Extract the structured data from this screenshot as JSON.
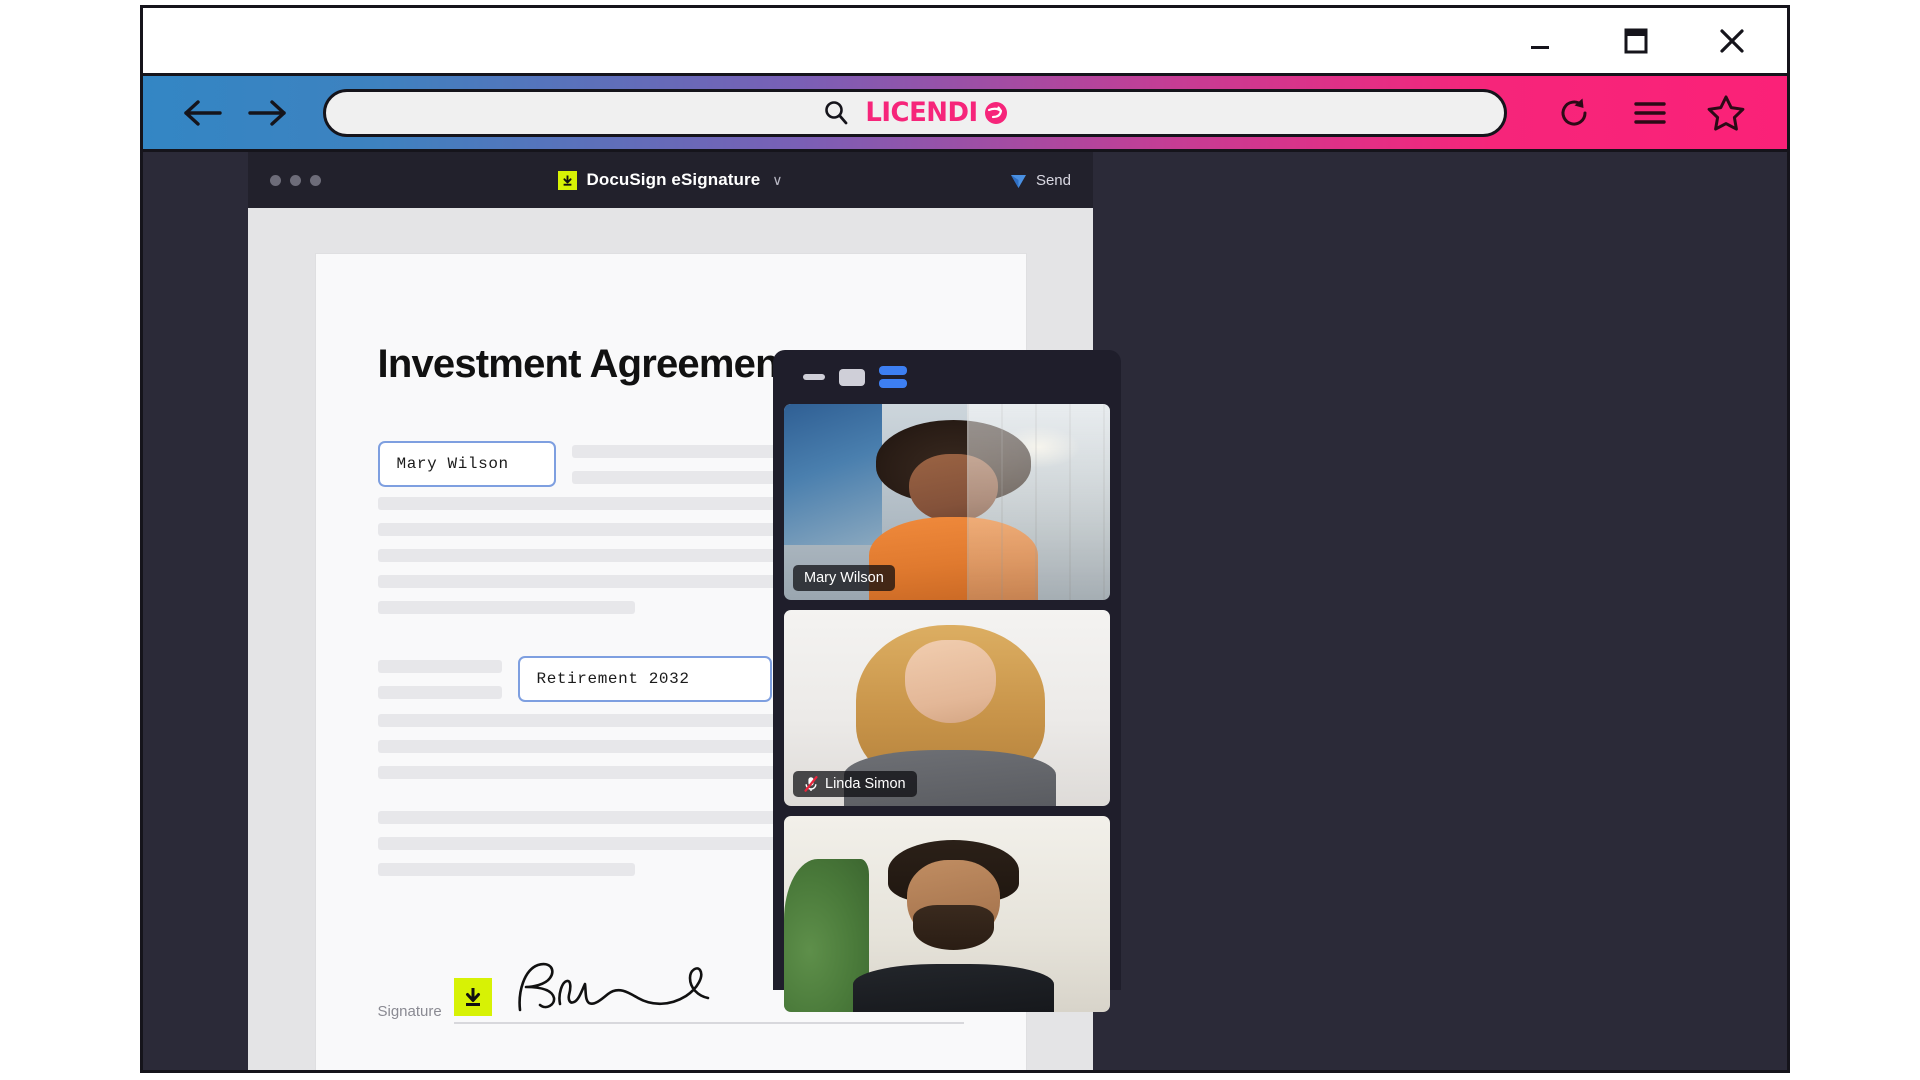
{
  "window": {
    "controls": [
      {
        "name": "minimize",
        "label": "Minimize"
      },
      {
        "name": "maximize",
        "label": "Maximize"
      },
      {
        "name": "close",
        "label": "Close"
      }
    ]
  },
  "browser": {
    "back_label": "Back",
    "forward_label": "Forward",
    "address_placeholder": "Search",
    "brand": "LICENDI",
    "brand_color": "#f6257a",
    "reload_label": "Reload",
    "menu_label": "Menu",
    "bookmark_label": "Bookmark",
    "toolbar_gradient_start": "#3386c4",
    "toolbar_gradient_end": "#fb2178"
  },
  "docusign": {
    "app_title": "DocuSign eSignature",
    "app_icon": "download-icon",
    "accent_color": "#d7f205",
    "chevron": "∨",
    "send_label": "Send",
    "document": {
      "title": "Investment Agreement",
      "fields": [
        {
          "name": "signer-name",
          "value": "Mary Wilson"
        },
        {
          "name": "plan-name",
          "value": "Retirement 2032"
        }
      ],
      "signature_label": "Signature",
      "signature_value": "Bmne"
    }
  },
  "video_call": {
    "layout_buttons": [
      {
        "name": "minimize-view",
        "active": false
      },
      {
        "name": "speaker-view",
        "active": false
      },
      {
        "name": "split-view",
        "active": true
      }
    ],
    "active_color": "#3d7ff2",
    "participants": [
      {
        "name": "Mary Wilson",
        "muted": false
      },
      {
        "name": "Linda Simon",
        "muted": true
      },
      {
        "name": "",
        "muted": false
      }
    ]
  }
}
